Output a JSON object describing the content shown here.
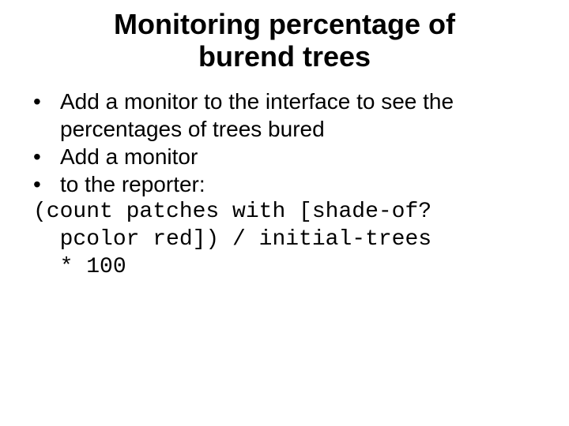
{
  "title_line1": "Monitoring percentage of",
  "title_line2": "burend trees",
  "bullets": {
    "b1": "Add a monitor to the interface to see the percentages of trees bured",
    "b2": "Add a monitor",
    "b3": "to the reporter:"
  },
  "code": "(count patches with [shade-of?\n  pcolor red]) / initial-trees\n  * 100"
}
